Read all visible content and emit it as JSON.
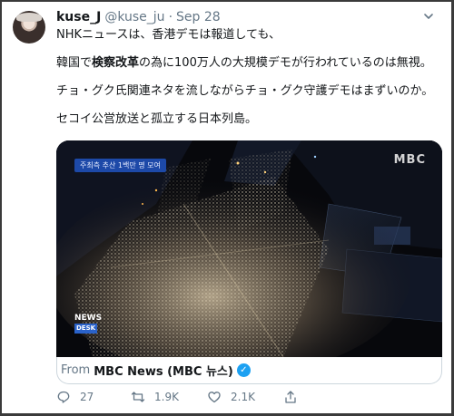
{
  "tweet": {
    "display_name": "kuse_J",
    "handle": "@kuse_ju",
    "separator": "·",
    "date": "Sep 28",
    "lines": [
      "NHKニュースは、香港デモは報道しても、",
      "韓国で検察改革の為に100万人の大規模デモが行われているのは無視。",
      "チョ・グク氏関連ネタを流しながらチョ・グク守護デモはまずいのか。",
      "セコイ公営放送と孤立する日本列島。"
    ],
    "line2_parts": [
      "韓国で",
      "検察改革",
      "の為に100万人の大規模デモが行われているのは無視。"
    ]
  },
  "media": {
    "overlay_caption": "주최측 추산 1백만 명 모여",
    "logo": "MBC",
    "badge_top": "NEWS",
    "badge_bottom": "DESK"
  },
  "source": {
    "from_label": "From",
    "name": "MBC News (MBC 뉴스)",
    "verified_icon": "verified-badge-icon"
  },
  "actions": {
    "replies": "27",
    "retweets": "1.9K",
    "likes": "2.1K"
  },
  "colors": {
    "accent": "#1da1f2",
    "secondary_text": "#657786",
    "border": "#ccd6dd"
  }
}
